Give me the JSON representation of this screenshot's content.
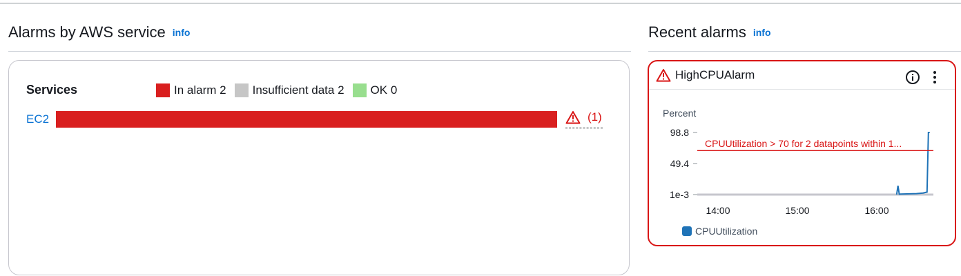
{
  "alarms_by_service": {
    "title": "Alarms by AWS service",
    "info_label": "info",
    "services_label": "Services",
    "legend": [
      {
        "label": "In alarm 2",
        "color": "#d91f1f"
      },
      {
        "label": "Insufficient data 2",
        "color": "#c6c6c6"
      },
      {
        "label": "OK 0",
        "color": "#98de8e"
      }
    ],
    "rows": [
      {
        "service": "EC2",
        "alarm_count_label": "(1)"
      }
    ]
  },
  "recent_alarms": {
    "title": "Recent alarms",
    "info_label": "info",
    "card": {
      "alarm_name": "HighCPUAlarm",
      "status_icon": "warning-icon",
      "info_icon": "info-circle-icon",
      "menu_icon": "vertical-ellipsis-icon",
      "y_unit": "Percent",
      "threshold_label": "CPUUtilization > 70 for 2 datapoints within 1...",
      "legend_label": "CPUUtilization",
      "series_color": "#1f73b7",
      "threshold_color": "#d91515"
    }
  },
  "chart_data": {
    "type": "line",
    "yticks": [
      "98.8",
      "49.4",
      "1e-3"
    ],
    "xticks": [
      "14:00",
      "15:00",
      "16:00"
    ],
    "ylim": [
      0.001,
      98.8
    ],
    "threshold": 70,
    "series": [
      {
        "name": "CPUUtilization",
        "x": [
          "16:15",
          "16:16",
          "16:17",
          "16:18",
          "16:25",
          "16:30",
          "16:35",
          "16:38",
          "16:39",
          "16:40"
        ],
        "values": [
          0.001,
          14,
          0.5,
          0.8,
          1.2,
          1.5,
          2.5,
          4,
          98.8,
          98.8
        ]
      }
    ]
  }
}
